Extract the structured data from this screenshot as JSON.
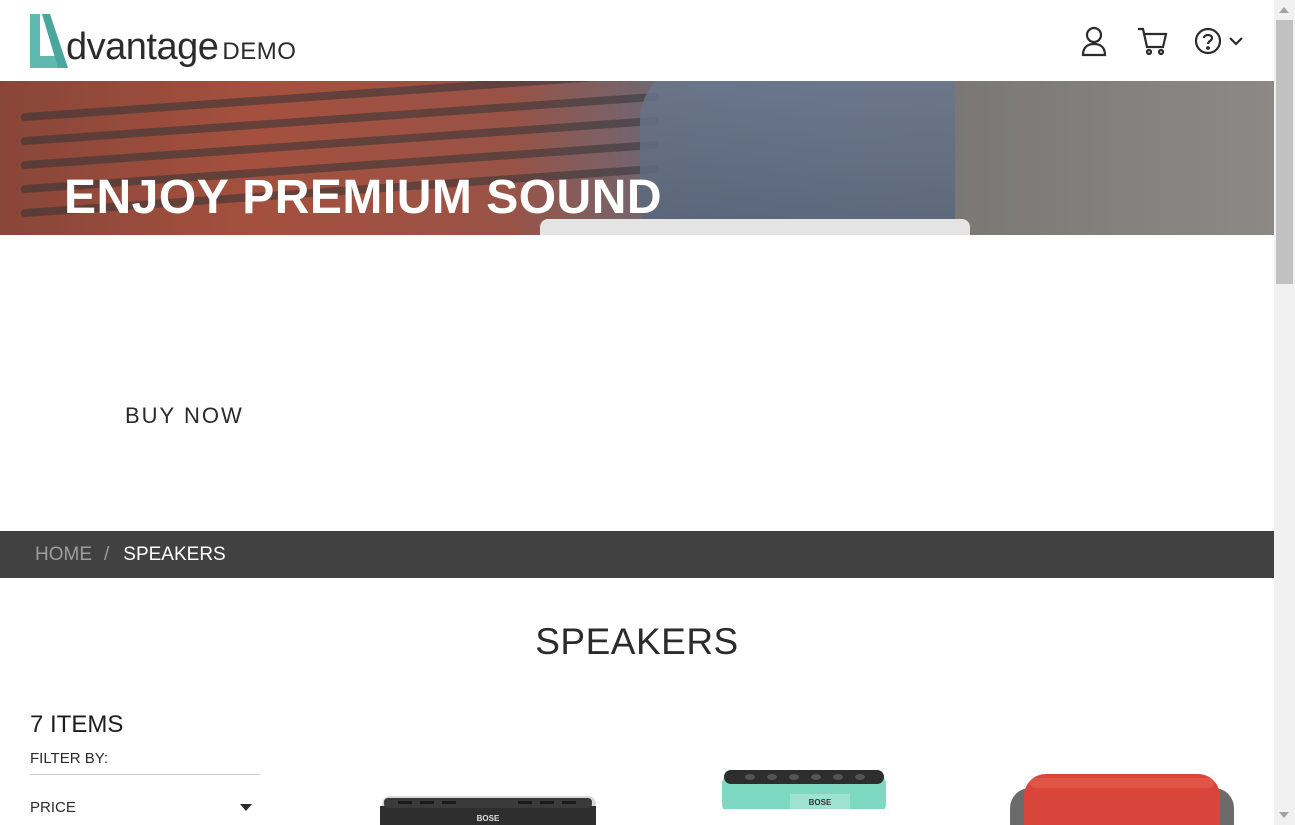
{
  "header": {
    "logo_word": "dvantage",
    "logo_suffix": "DEMO",
    "icons": [
      "user-icon",
      "cart-icon",
      "help-icon",
      "chevron-down-icon"
    ]
  },
  "hero": {
    "title": "ENJOY PREMIUM SOUND"
  },
  "cta": {
    "buy_now": "BUY NOW"
  },
  "breadcrumb": {
    "home": "HOME",
    "separator": "/",
    "current": "SPEAKERS"
  },
  "category": {
    "title": "SPEAKERS",
    "items_count": "7 ITEMS",
    "filter_by": "FILTER BY:",
    "filters": [
      {
        "label": "PRICE"
      }
    ]
  },
  "products": [
    {
      "brand": "BOSE",
      "color": "#2e2e2e"
    },
    {
      "brand": "BOSE",
      "color": "#7fd8c2"
    },
    {
      "brand": "",
      "color": "#d8453b"
    }
  ],
  "colors": {
    "accent": "#5fb9b0",
    "breadcrumb_bg": "#414141",
    "text": "#2b2b2b"
  }
}
